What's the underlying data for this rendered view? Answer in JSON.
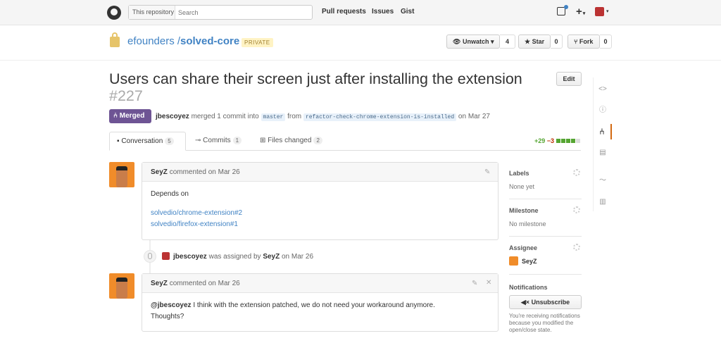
{
  "header": {
    "search_scope": "This repository",
    "search_placeholder": "Search",
    "nav": [
      "Pull requests",
      "Issues",
      "Gist"
    ],
    "plus": "+"
  },
  "repo": {
    "owner": "efounders",
    "separator": "/",
    "name": "solved-core",
    "visibility": "PRIVATE",
    "watch_label": "Unwatch",
    "watch_count": "4",
    "star_label": "Star",
    "star_count": "0",
    "fork_label": "Fork",
    "fork_count": "0"
  },
  "pr": {
    "title": "Users can share their screen just after installing the extension",
    "number": "#227",
    "edit_label": "Edit",
    "state": "Merged",
    "merger": "jbescoyez",
    "merge_text": "merged 1 commit into",
    "base_branch": "master",
    "from_text": "from",
    "head_branch": "refactor-check-chrome-extension-is-installed",
    "date_text": "on Mar 27"
  },
  "tabs": [
    {
      "label": "Conversation",
      "count": "5"
    },
    {
      "label": "Commits",
      "count": "1"
    },
    {
      "label": "Files changed",
      "count": "2"
    }
  ],
  "diffstat": {
    "additions": "+29",
    "deletions": "−3"
  },
  "comments": [
    {
      "author": "SeyZ",
      "action": "commented on Mar 26",
      "body_text": "Depends on",
      "links": [
        "solvedio/chrome-extension#2",
        "solvedio/firefox-extension#1"
      ]
    },
    {
      "author": "SeyZ",
      "action": "commented on Mar 26",
      "mention": "@jbescoyez",
      "body_line1": "I think with the extension patched, we do not need your workaround anymore.",
      "body_line2": "Thoughts?"
    }
  ],
  "event": {
    "actor": "jbescoyez",
    "text1": "was assigned by",
    "by": "SeyZ",
    "text2": "on Mar 26"
  },
  "sidebar": {
    "labels_head": "Labels",
    "labels_val": "None yet",
    "milestone_head": "Milestone",
    "milestone_val": "No milestone",
    "assignee_head": "Assignee",
    "assignee_val": "SeyZ",
    "notif_head": "Notifications",
    "unsub_label": "Unsubscribe",
    "notif_text": "You're receiving notifications because you modified the open/close state."
  },
  "colors": {
    "merged": "#6e5494",
    "link": "#4183c4",
    "addition": "#55a532",
    "deletion": "#bd2c00"
  }
}
